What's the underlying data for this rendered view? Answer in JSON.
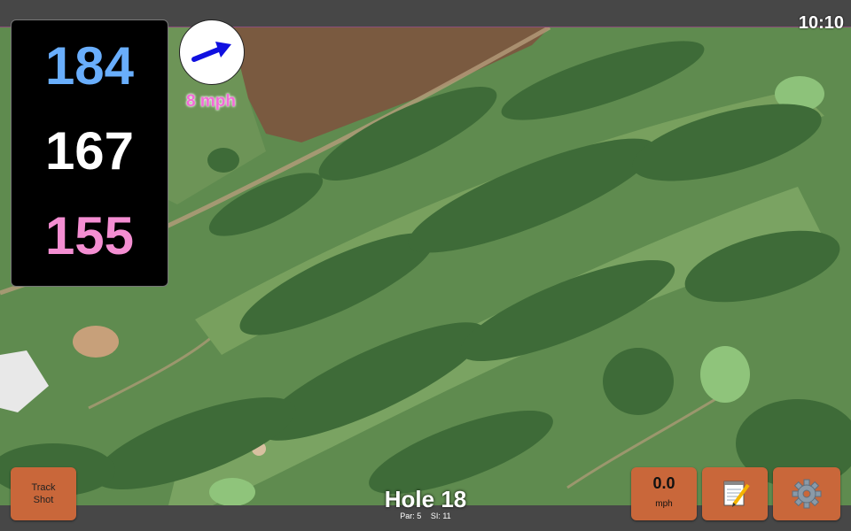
{
  "status_bar": {
    "time": "10:10"
  },
  "distances": {
    "back": "184",
    "middle": "167",
    "front": "155"
  },
  "colors": {
    "back": "#69aefc",
    "middle": "#ffffff",
    "front": "#f48ed2",
    "button": "#c9673a",
    "wind_arrow": "#1010e0"
  },
  "wind": {
    "speed_label": "8 mph",
    "direction_icon": "arrow-icon"
  },
  "buttons": {
    "track_shot_line1": "Track",
    "track_shot_line2": "Shot",
    "speed_value": "0.0",
    "speed_unit": "mph",
    "notes_icon": "notepad-icon",
    "settings_icon": "gear-icon"
  },
  "hole": {
    "title": "Hole 18",
    "par": "Par: 5",
    "si": "SI: 11"
  }
}
